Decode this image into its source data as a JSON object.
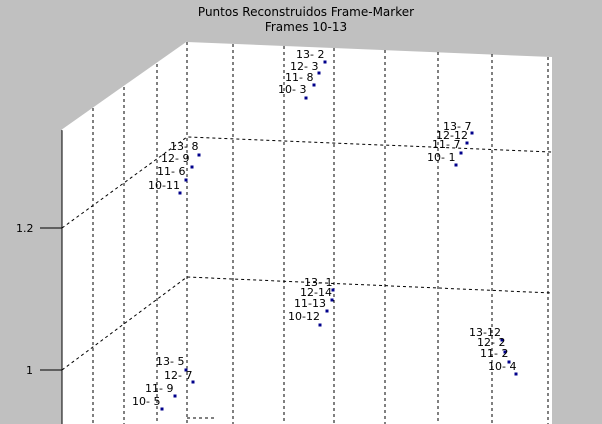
{
  "chart_data": {
    "type": "scatter",
    "title": "Puntos Reconstruidos Frame-Marker",
    "subtitle": "Frames 10-13",
    "z_ticks": [
      "1.2",
      "1"
    ],
    "grid": true,
    "marker_color": "#00008b",
    "groups": [
      {
        "points": [
          {
            "label": "13- 2",
            "z": 1.4
          },
          {
            "label": "12- 3",
            "z": 1.38
          },
          {
            "label": "11- 8",
            "z": 1.36
          },
          {
            "label": "10- 3",
            "z": 1.34
          }
        ]
      },
      {
        "points": [
          {
            "label": "13- 7",
            "z": 1.31
          },
          {
            "label": "12-12",
            "z": 1.3
          },
          {
            "label": "11- 7",
            "z": 1.29
          },
          {
            "label": "10- 1",
            "z": 1.28
          }
        ]
      },
      {
        "points": [
          {
            "label": "13- 8",
            "z": 1.29
          },
          {
            "label": "12- 9",
            "z": 1.28
          },
          {
            "label": "11- 6",
            "z": 1.27
          },
          {
            "label": "10-11",
            "z": 1.26
          }
        ]
      },
      {
        "points": [
          {
            "label": "13- 1",
            "z": 1.09
          },
          {
            "label": "12-14",
            "z": 1.08
          },
          {
            "label": "11-13",
            "z": 1.07
          },
          {
            "label": "10-12",
            "z": 1.06
          }
        ]
      },
      {
        "points": [
          {
            "label": "13-12",
            "z": 1.04
          },
          {
            "label": "12- 2",
            "z": 1.03
          },
          {
            "label": "11- 2",
            "z": 1.02
          },
          {
            "label": "10- 4",
            "z": 1.01
          }
        ]
      },
      {
        "points": [
          {
            "label": "13- 5",
            "z": 1.0
          },
          {
            "label": "12- 7",
            "z": 0.99
          },
          {
            "label": "11- 9",
            "z": 0.98
          },
          {
            "label": "10- 5",
            "z": 0.97
          }
        ]
      }
    ]
  }
}
